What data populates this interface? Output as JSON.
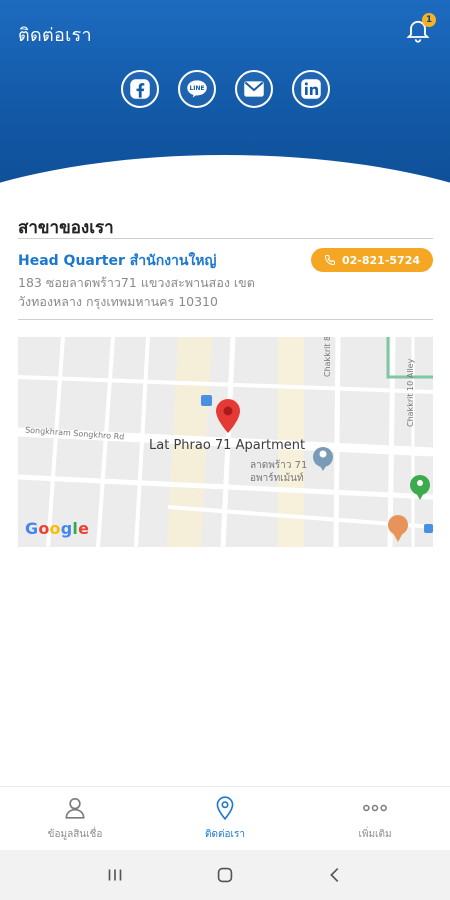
{
  "header": {
    "title": "ติดต่อเรา",
    "notification_count": "1",
    "socials": [
      {
        "name": "facebook",
        "icon": "facebook-icon"
      },
      {
        "name": "line",
        "icon": "line-icon"
      },
      {
        "name": "email",
        "icon": "mail-icon"
      },
      {
        "name": "linkedin",
        "icon": "linkedin-icon"
      }
    ]
  },
  "section": {
    "title": "สาขาของเรา"
  },
  "branch": {
    "name": "Head Quarter สำนักงานใหญ่",
    "phone": "02-821-5724",
    "address": "183 ซอยลาดพร้าว71 แขวงสะพานสอง เขตวังทองหลาง กรุงเทพมหานคร 10310"
  },
  "map": {
    "road_label": "Songkhram Songkhro Rd",
    "alley_label_1": "Chakkrit 8 Alley",
    "alley_label_2": "Chakkrit 10 Alley",
    "place_name": "Lat Phrao 71 Apartment",
    "place_name_th_1": "ลาดพร้าว 71",
    "place_name_th_2": "อพาร์ทเม้นท์",
    "attribution": "Google"
  },
  "bottom_nav": {
    "items": [
      {
        "label": "ข้อมูลสินเชื่อ",
        "icon": "person-icon"
      },
      {
        "label": "ติดต่อเรา",
        "icon": "location-pin-icon"
      },
      {
        "label": "เพิ่มเติม",
        "icon": "more-icon"
      }
    ]
  },
  "colors": {
    "brand_blue": "#135aa8",
    "accent_orange": "#f5a623",
    "link_blue": "#1a78cf"
  }
}
